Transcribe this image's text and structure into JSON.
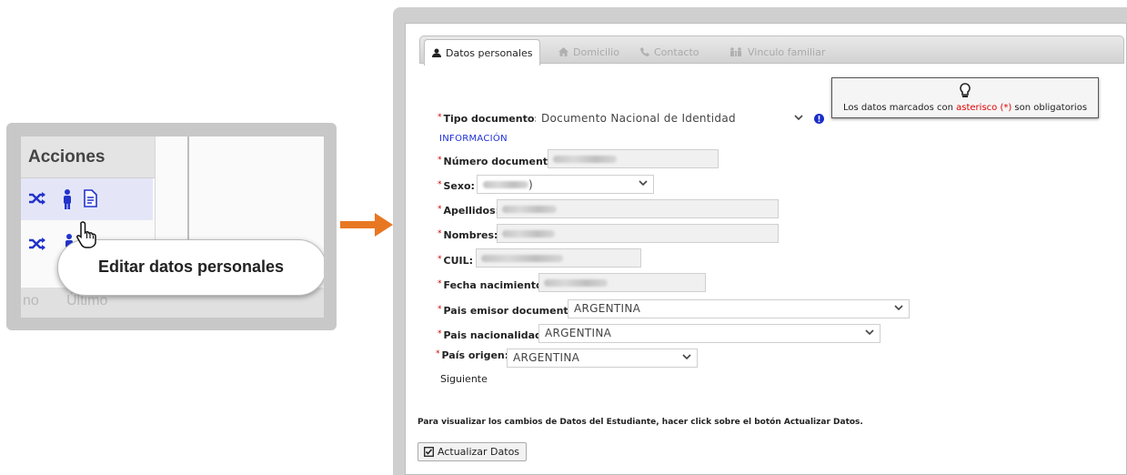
{
  "callout": {
    "header": "Acciones",
    "tooltip": "Editar datos personales",
    "strip_left": "no",
    "strip_right": "Último"
  },
  "tabs": [
    {
      "label": "Datos personales",
      "icon": "user-icon",
      "active": true
    },
    {
      "label": "Domicilio",
      "icon": "home-icon",
      "active": false
    },
    {
      "label": "Contacto",
      "icon": "phone-icon",
      "active": false
    },
    {
      "label": "Vinculo familiar",
      "icon": "family-icon",
      "active": false
    }
  ],
  "info_box": {
    "prefix": "Los datos marcados con ",
    "highlight": "asterisco (*)",
    "suffix": " son obligatorios"
  },
  "form": {
    "asterisk": "*",
    "tipo_documento": {
      "label": "Tipo documento:",
      "value": "Documento Nacional de Identidad"
    },
    "informacion_link": "INFORMACIÓN",
    "numero_documento": {
      "label": "Número documento:"
    },
    "sexo": {
      "label": "Sexo:",
      "value": ")"
    },
    "apellidos": {
      "label": "Apellidos:"
    },
    "nombres": {
      "label": "Nombres:"
    },
    "cuil": {
      "label": "CUIL:"
    },
    "fecha_nacimiento": {
      "label": "Fecha nacimiento:"
    },
    "pais_emisor": {
      "label": "Pais emisor documento:",
      "value": "ARGENTINA"
    },
    "pais_nacionalidad": {
      "label": "Pais nacionalidad:",
      "value": "ARGENTINA"
    },
    "pais_origen": {
      "label": "País origen:",
      "value": "ARGENTINA"
    },
    "siguiente": "Siguiente"
  },
  "note": "Para visualizar los cambios de Datos del Estudiante, hacer click sobre el botón Actualizar Datos.",
  "update_button": "Actualizar Datos",
  "colors": {
    "arrow": "#e87722",
    "required": "#d00000",
    "link": "#1f2fd6",
    "icon_blue": "#2233cc"
  }
}
